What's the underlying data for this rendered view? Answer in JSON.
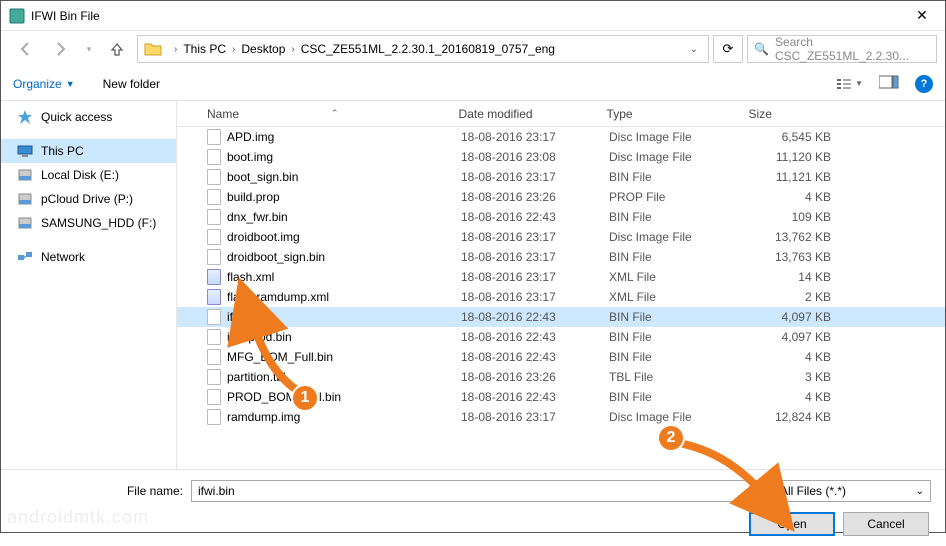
{
  "window": {
    "title": "IFWI Bin File"
  },
  "breadcrumb": {
    "parts": [
      "This PC",
      "Desktop",
      "CSC_ZE551ML_2.2.30.1_20160819_0757_eng"
    ]
  },
  "search": {
    "placeholder": "Search CSC_ZE551ML_2.2.30..."
  },
  "toolbar": {
    "organize": "Organize",
    "newfolder": "New folder"
  },
  "sidebar": {
    "items": [
      {
        "label": "Quick access",
        "icon": "star"
      },
      {
        "label": "This PC",
        "icon": "pc",
        "selected": true
      },
      {
        "label": "Local Disk (E:)",
        "icon": "disk"
      },
      {
        "label": "pCloud Drive (P:)",
        "icon": "disk"
      },
      {
        "label": "SAMSUNG_HDD (F:)",
        "icon": "disk"
      },
      {
        "label": "Network",
        "icon": "net"
      }
    ]
  },
  "columns": {
    "name": "Name",
    "date": "Date modified",
    "type": "Type",
    "size": "Size"
  },
  "files": [
    {
      "name": "APD.img",
      "date": "18-08-2016 23:17",
      "type": "Disc Image File",
      "size": "6,545 KB"
    },
    {
      "name": "boot.img",
      "date": "18-08-2016 23:08",
      "type": "Disc Image File",
      "size": "11,120 KB"
    },
    {
      "name": "boot_sign.bin",
      "date": "18-08-2016 23:17",
      "type": "BIN File",
      "size": "11,121 KB"
    },
    {
      "name": "build.prop",
      "date": "18-08-2016 23:26",
      "type": "PROP File",
      "size": "4 KB"
    },
    {
      "name": "dnx_fwr.bin",
      "date": "18-08-2016 22:43",
      "type": "BIN File",
      "size": "109 KB"
    },
    {
      "name": "droidboot.img",
      "date": "18-08-2016 23:17",
      "type": "Disc Image File",
      "size": "13,762 KB"
    },
    {
      "name": "droidboot_sign.bin",
      "date": "18-08-2016 23:17",
      "type": "BIN File",
      "size": "13,763 KB"
    },
    {
      "name": "flash.xml",
      "date": "18-08-2016 23:17",
      "type": "XML File",
      "size": "14 KB",
      "xml": true
    },
    {
      "name": "flash-ramdump.xml",
      "date": "18-08-2016 23:17",
      "type": "XML File",
      "size": "2 KB",
      "xml": true
    },
    {
      "name": "ifwi.bin",
      "date": "18-08-2016 22:43",
      "type": "BIN File",
      "size": "4,097 KB",
      "selected": true
    },
    {
      "name": "ifwi-prod.bin",
      "date": "18-08-2016 22:43",
      "type": "BIN File",
      "size": "4,097 KB"
    },
    {
      "name": "MFG_BOM_Full.bin",
      "date": "18-08-2016 22:43",
      "type": "BIN File",
      "size": "4 KB"
    },
    {
      "name": "partition.tbl",
      "date": "18-08-2016 23:26",
      "type": "TBL File",
      "size": "3 KB"
    },
    {
      "name": "PROD_BOM_Full.bin",
      "date": "18-08-2016 22:43",
      "type": "BIN File",
      "size": "4 KB"
    },
    {
      "name": "ramdump.img",
      "date": "18-08-2016 23:17",
      "type": "Disc Image File",
      "size": "12,824 KB"
    }
  ],
  "bottom": {
    "filename_label": "File name:",
    "filename_value": "ifwi.bin",
    "filter_label": "All Files (*.*)",
    "open": "Open",
    "cancel": "Cancel"
  },
  "annotations": {
    "badge1": "1",
    "badge2": "2"
  },
  "watermark": "androidmtk.com"
}
